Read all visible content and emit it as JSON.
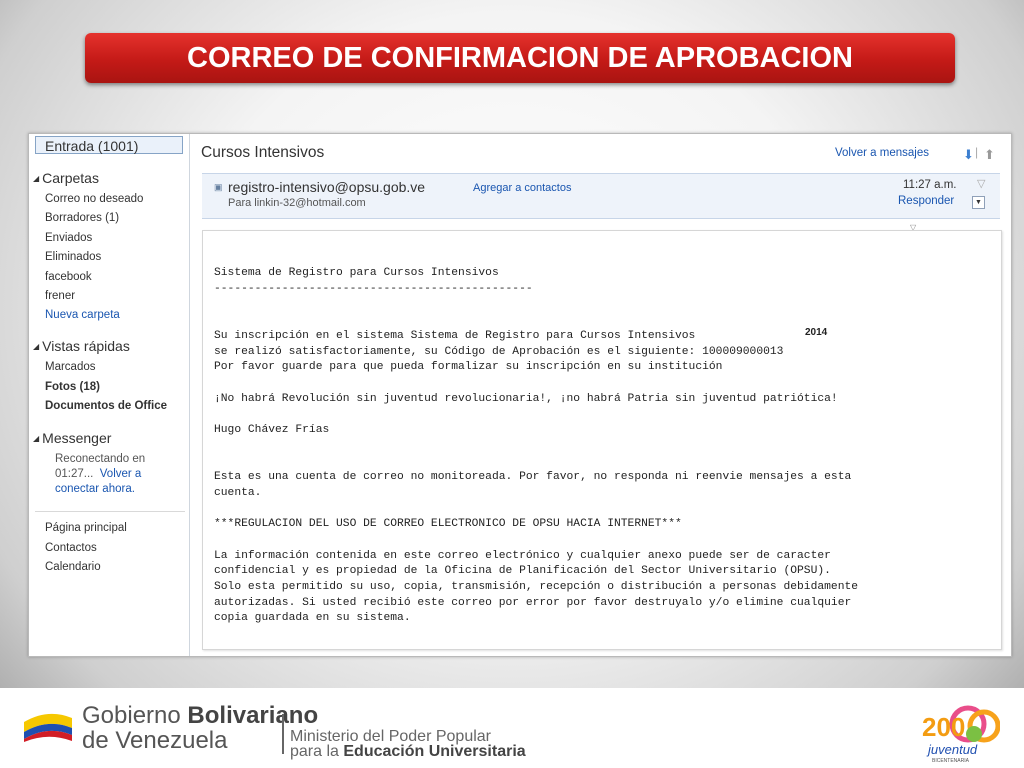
{
  "slide_title": "CORREO DE CONFIRMACION DE APROBACION",
  "sidebar": {
    "inbox": "Entrada (1001)",
    "folders_header": "Carpetas",
    "folders": [
      "Correo no deseado",
      "Borradores (1)",
      "Enviados",
      "Eliminados",
      "facebook",
      "frener"
    ],
    "new_folder": "Nueva carpeta",
    "quick_header": "Vistas rápidas",
    "quick": [
      "Marcados",
      "Fotos (18)",
      "Documentos de Office"
    ],
    "messenger_header": "Messenger",
    "messenger_status_1": "Reconectando en",
    "messenger_status_2": "01:27...",
    "messenger_reconnect_1": "Volver a",
    "messenger_reconnect_2": "conectar ahora.",
    "links": [
      "Página principal",
      "Contactos",
      "Calendario"
    ]
  },
  "email": {
    "subject": "Cursos Intensivos",
    "back_link": "Volver a mensajes",
    "sender": "registro-intensivo@opsu.gob.ve",
    "add_contact": "Agregar a contactos",
    "to": "Para linkin-32@hotmail.com",
    "time": "11:27 a.m.",
    "reply": "Responder",
    "year_tag": "2014",
    "body": [
      "Sistema de Registro para Cursos Intensivos",
      "-----------------------------------------------",
      "",
      "",
      "Su inscripción en el sistema Sistema de Registro para Cursos Intensivos",
      "se realizó satisfactoriamente, su Código de Aprobación es el siguiente: 100009000013",
      "Por favor guarde para que pueda formalizar su inscripción en su institución",
      "",
      "¡No habrá Revolución sin juventud revolucionaria!, ¡no habrá Patria sin juventud patriótica!",
      "",
      "Hugo Chávez Frías",
      "",
      "",
      "Esta es una cuenta de correo no monitoreada. Por favor, no responda ni reenvie mensajes a esta",
      "cuenta.",
      "",
      "***REGULACION DEL USO DE CORREO ELECTRONICO DE OPSU HACIA INTERNET***",
      "",
      "La información contenida en este correo electrónico y cualquier anexo puede ser de caracter",
      "confidencial y es propiedad de la Oficina de Planificación del Sector Universitario (OPSU).",
      "Solo esta permitido su uso, copia, transmisión, recepción o distribución a personas debidamente",
      "autorizadas. Si usted recibió este correo por error por favor destruyalo y/o elimine cualquier",
      "copia guardada en su sistema."
    ]
  },
  "footer": {
    "gov_line1_a": "Gobierno ",
    "gov_line1_b": "Bolivariano",
    "gov_line2": "de Venezuela",
    "ministry_line1": "Ministerio del Poder Popular",
    "ministry_line2_a": "para la ",
    "ministry_line2_b": "Educación Universitaria",
    "logo_year": "200",
    "logo_text": "juventud",
    "logo_sub": "BICENTENARIA"
  }
}
